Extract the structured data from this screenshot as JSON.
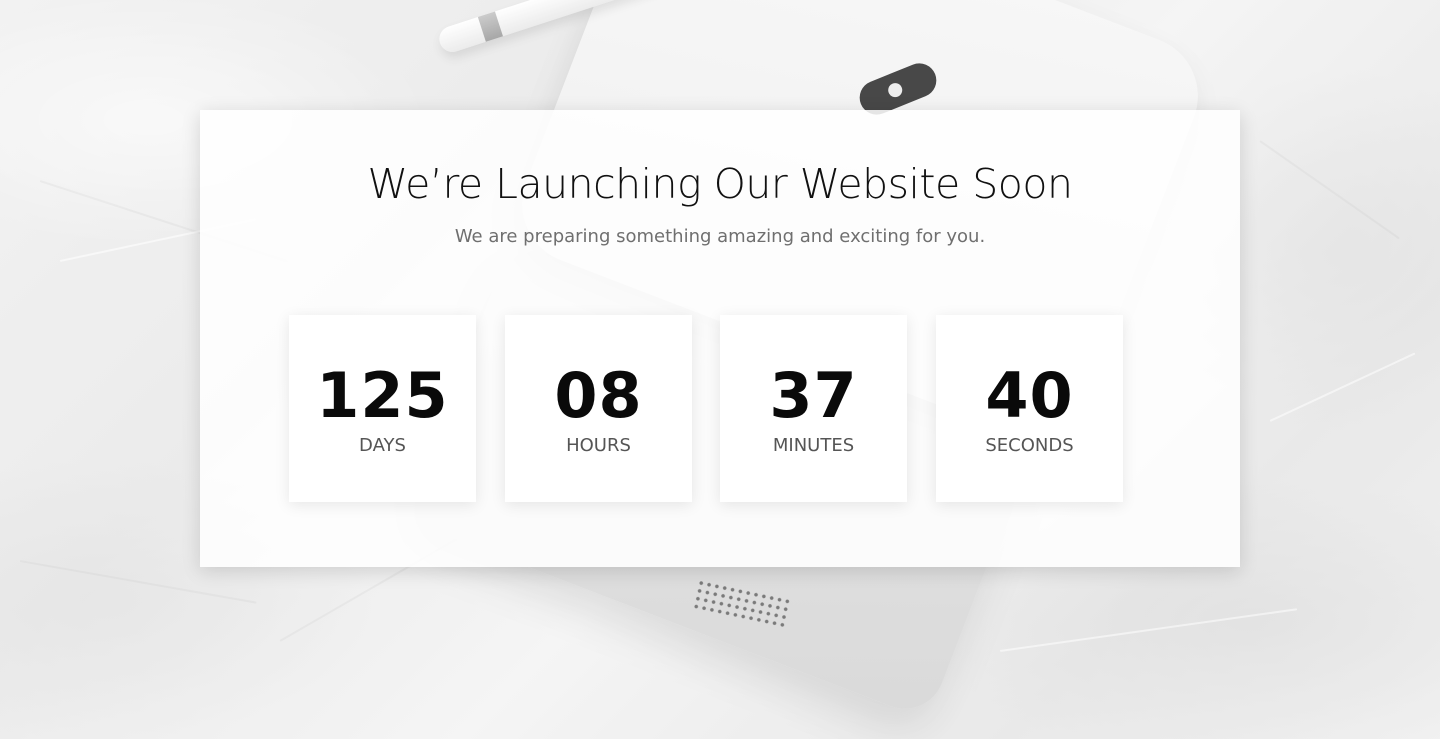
{
  "page": {
    "title": "We’re Launching Our Website Soon",
    "subtitle": "We are preparing something amazing and exciting for you."
  },
  "countdown": [
    {
      "value": "125",
      "label": "DAYS"
    },
    {
      "value": "08",
      "label": "HOURS"
    },
    {
      "value": "37",
      "label": "MINUTES"
    },
    {
      "value": "40",
      "label": "SECONDS"
    }
  ],
  "colors": {
    "card_background": "#ffffff",
    "title_text": "#111111",
    "subtitle_text": "#6f6f6f",
    "number_text": "#0a0a0a",
    "label_text": "#555555"
  }
}
